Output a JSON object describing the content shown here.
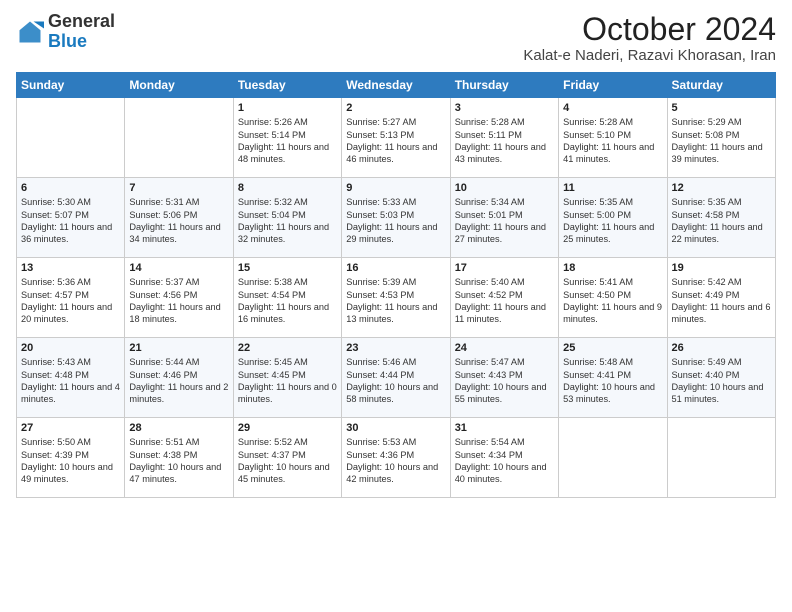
{
  "header": {
    "logo_general": "General",
    "logo_blue": "Blue",
    "title": "October 2024",
    "subtitle": "Kalat-e Naderi, Razavi Khorasan, Iran"
  },
  "days_of_week": [
    "Sunday",
    "Monday",
    "Tuesday",
    "Wednesday",
    "Thursday",
    "Friday",
    "Saturday"
  ],
  "weeks": [
    [
      {
        "day": "",
        "content": ""
      },
      {
        "day": "",
        "content": ""
      },
      {
        "day": "1",
        "content": "Sunrise: 5:26 AM\nSunset: 5:14 PM\nDaylight: 11 hours and 48 minutes."
      },
      {
        "day": "2",
        "content": "Sunrise: 5:27 AM\nSunset: 5:13 PM\nDaylight: 11 hours and 46 minutes."
      },
      {
        "day": "3",
        "content": "Sunrise: 5:28 AM\nSunset: 5:11 PM\nDaylight: 11 hours and 43 minutes."
      },
      {
        "day": "4",
        "content": "Sunrise: 5:28 AM\nSunset: 5:10 PM\nDaylight: 11 hours and 41 minutes."
      },
      {
        "day": "5",
        "content": "Sunrise: 5:29 AM\nSunset: 5:08 PM\nDaylight: 11 hours and 39 minutes."
      }
    ],
    [
      {
        "day": "6",
        "content": "Sunrise: 5:30 AM\nSunset: 5:07 PM\nDaylight: 11 hours and 36 minutes."
      },
      {
        "day": "7",
        "content": "Sunrise: 5:31 AM\nSunset: 5:06 PM\nDaylight: 11 hours and 34 minutes."
      },
      {
        "day": "8",
        "content": "Sunrise: 5:32 AM\nSunset: 5:04 PM\nDaylight: 11 hours and 32 minutes."
      },
      {
        "day": "9",
        "content": "Sunrise: 5:33 AM\nSunset: 5:03 PM\nDaylight: 11 hours and 29 minutes."
      },
      {
        "day": "10",
        "content": "Sunrise: 5:34 AM\nSunset: 5:01 PM\nDaylight: 11 hours and 27 minutes."
      },
      {
        "day": "11",
        "content": "Sunrise: 5:35 AM\nSunset: 5:00 PM\nDaylight: 11 hours and 25 minutes."
      },
      {
        "day": "12",
        "content": "Sunrise: 5:35 AM\nSunset: 4:58 PM\nDaylight: 11 hours and 22 minutes."
      }
    ],
    [
      {
        "day": "13",
        "content": "Sunrise: 5:36 AM\nSunset: 4:57 PM\nDaylight: 11 hours and 20 minutes."
      },
      {
        "day": "14",
        "content": "Sunrise: 5:37 AM\nSunset: 4:56 PM\nDaylight: 11 hours and 18 minutes."
      },
      {
        "day": "15",
        "content": "Sunrise: 5:38 AM\nSunset: 4:54 PM\nDaylight: 11 hours and 16 minutes."
      },
      {
        "day": "16",
        "content": "Sunrise: 5:39 AM\nSunset: 4:53 PM\nDaylight: 11 hours and 13 minutes."
      },
      {
        "day": "17",
        "content": "Sunrise: 5:40 AM\nSunset: 4:52 PM\nDaylight: 11 hours and 11 minutes."
      },
      {
        "day": "18",
        "content": "Sunrise: 5:41 AM\nSunset: 4:50 PM\nDaylight: 11 hours and 9 minutes."
      },
      {
        "day": "19",
        "content": "Sunrise: 5:42 AM\nSunset: 4:49 PM\nDaylight: 11 hours and 6 minutes."
      }
    ],
    [
      {
        "day": "20",
        "content": "Sunrise: 5:43 AM\nSunset: 4:48 PM\nDaylight: 11 hours and 4 minutes."
      },
      {
        "day": "21",
        "content": "Sunrise: 5:44 AM\nSunset: 4:46 PM\nDaylight: 11 hours and 2 minutes."
      },
      {
        "day": "22",
        "content": "Sunrise: 5:45 AM\nSunset: 4:45 PM\nDaylight: 11 hours and 0 minutes."
      },
      {
        "day": "23",
        "content": "Sunrise: 5:46 AM\nSunset: 4:44 PM\nDaylight: 10 hours and 58 minutes."
      },
      {
        "day": "24",
        "content": "Sunrise: 5:47 AM\nSunset: 4:43 PM\nDaylight: 10 hours and 55 minutes."
      },
      {
        "day": "25",
        "content": "Sunrise: 5:48 AM\nSunset: 4:41 PM\nDaylight: 10 hours and 53 minutes."
      },
      {
        "day": "26",
        "content": "Sunrise: 5:49 AM\nSunset: 4:40 PM\nDaylight: 10 hours and 51 minutes."
      }
    ],
    [
      {
        "day": "27",
        "content": "Sunrise: 5:50 AM\nSunset: 4:39 PM\nDaylight: 10 hours and 49 minutes."
      },
      {
        "day": "28",
        "content": "Sunrise: 5:51 AM\nSunset: 4:38 PM\nDaylight: 10 hours and 47 minutes."
      },
      {
        "day": "29",
        "content": "Sunrise: 5:52 AM\nSunset: 4:37 PM\nDaylight: 10 hours and 45 minutes."
      },
      {
        "day": "30",
        "content": "Sunrise: 5:53 AM\nSunset: 4:36 PM\nDaylight: 10 hours and 42 minutes."
      },
      {
        "day": "31",
        "content": "Sunrise: 5:54 AM\nSunset: 4:34 PM\nDaylight: 10 hours and 40 minutes."
      },
      {
        "day": "",
        "content": ""
      },
      {
        "day": "",
        "content": ""
      }
    ]
  ]
}
